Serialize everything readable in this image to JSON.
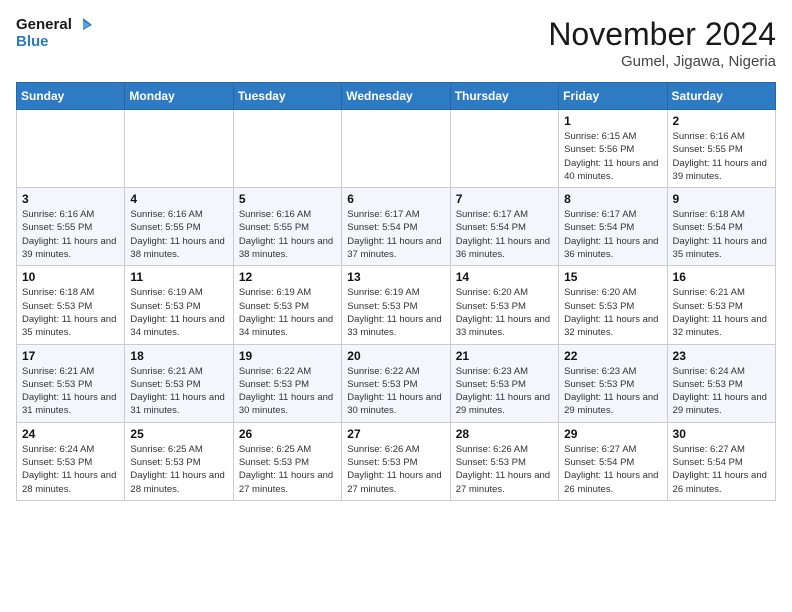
{
  "logo": {
    "line1": "General",
    "line2": "Blue"
  },
  "title": "November 2024",
  "location": "Gumel, Jigawa, Nigeria",
  "weekdays": [
    "Sunday",
    "Monday",
    "Tuesday",
    "Wednesday",
    "Thursday",
    "Friday",
    "Saturday"
  ],
  "weeks": [
    [
      {
        "day": "",
        "info": ""
      },
      {
        "day": "",
        "info": ""
      },
      {
        "day": "",
        "info": ""
      },
      {
        "day": "",
        "info": ""
      },
      {
        "day": "",
        "info": ""
      },
      {
        "day": "1",
        "info": "Sunrise: 6:15 AM\nSunset: 5:56 PM\nDaylight: 11 hours\nand 40 minutes."
      },
      {
        "day": "2",
        "info": "Sunrise: 6:16 AM\nSunset: 5:55 PM\nDaylight: 11 hours\nand 39 minutes."
      }
    ],
    [
      {
        "day": "3",
        "info": "Sunrise: 6:16 AM\nSunset: 5:55 PM\nDaylight: 11 hours\nand 39 minutes."
      },
      {
        "day": "4",
        "info": "Sunrise: 6:16 AM\nSunset: 5:55 PM\nDaylight: 11 hours\nand 38 minutes."
      },
      {
        "day": "5",
        "info": "Sunrise: 6:16 AM\nSunset: 5:55 PM\nDaylight: 11 hours\nand 38 minutes."
      },
      {
        "day": "6",
        "info": "Sunrise: 6:17 AM\nSunset: 5:54 PM\nDaylight: 11 hours\nand 37 minutes."
      },
      {
        "day": "7",
        "info": "Sunrise: 6:17 AM\nSunset: 5:54 PM\nDaylight: 11 hours\nand 36 minutes."
      },
      {
        "day": "8",
        "info": "Sunrise: 6:17 AM\nSunset: 5:54 PM\nDaylight: 11 hours\nand 36 minutes."
      },
      {
        "day": "9",
        "info": "Sunrise: 6:18 AM\nSunset: 5:54 PM\nDaylight: 11 hours\nand 35 minutes."
      }
    ],
    [
      {
        "day": "10",
        "info": "Sunrise: 6:18 AM\nSunset: 5:53 PM\nDaylight: 11 hours\nand 35 minutes."
      },
      {
        "day": "11",
        "info": "Sunrise: 6:19 AM\nSunset: 5:53 PM\nDaylight: 11 hours\nand 34 minutes."
      },
      {
        "day": "12",
        "info": "Sunrise: 6:19 AM\nSunset: 5:53 PM\nDaylight: 11 hours\nand 34 minutes."
      },
      {
        "day": "13",
        "info": "Sunrise: 6:19 AM\nSunset: 5:53 PM\nDaylight: 11 hours\nand 33 minutes."
      },
      {
        "day": "14",
        "info": "Sunrise: 6:20 AM\nSunset: 5:53 PM\nDaylight: 11 hours\nand 33 minutes."
      },
      {
        "day": "15",
        "info": "Sunrise: 6:20 AM\nSunset: 5:53 PM\nDaylight: 11 hours\nand 32 minutes."
      },
      {
        "day": "16",
        "info": "Sunrise: 6:21 AM\nSunset: 5:53 PM\nDaylight: 11 hours\nand 32 minutes."
      }
    ],
    [
      {
        "day": "17",
        "info": "Sunrise: 6:21 AM\nSunset: 5:53 PM\nDaylight: 11 hours\nand 31 minutes."
      },
      {
        "day": "18",
        "info": "Sunrise: 6:21 AM\nSunset: 5:53 PM\nDaylight: 11 hours\nand 31 minutes."
      },
      {
        "day": "19",
        "info": "Sunrise: 6:22 AM\nSunset: 5:53 PM\nDaylight: 11 hours\nand 30 minutes."
      },
      {
        "day": "20",
        "info": "Sunrise: 6:22 AM\nSunset: 5:53 PM\nDaylight: 11 hours\nand 30 minutes."
      },
      {
        "day": "21",
        "info": "Sunrise: 6:23 AM\nSunset: 5:53 PM\nDaylight: 11 hours\nand 29 minutes."
      },
      {
        "day": "22",
        "info": "Sunrise: 6:23 AM\nSunset: 5:53 PM\nDaylight: 11 hours\nand 29 minutes."
      },
      {
        "day": "23",
        "info": "Sunrise: 6:24 AM\nSunset: 5:53 PM\nDaylight: 11 hours\nand 29 minutes."
      }
    ],
    [
      {
        "day": "24",
        "info": "Sunrise: 6:24 AM\nSunset: 5:53 PM\nDaylight: 11 hours\nand 28 minutes."
      },
      {
        "day": "25",
        "info": "Sunrise: 6:25 AM\nSunset: 5:53 PM\nDaylight: 11 hours\nand 28 minutes."
      },
      {
        "day": "26",
        "info": "Sunrise: 6:25 AM\nSunset: 5:53 PM\nDaylight: 11 hours\nand 27 minutes."
      },
      {
        "day": "27",
        "info": "Sunrise: 6:26 AM\nSunset: 5:53 PM\nDaylight: 11 hours\nand 27 minutes."
      },
      {
        "day": "28",
        "info": "Sunrise: 6:26 AM\nSunset: 5:53 PM\nDaylight: 11 hours\nand 27 minutes."
      },
      {
        "day": "29",
        "info": "Sunrise: 6:27 AM\nSunset: 5:54 PM\nDaylight: 11 hours\nand 26 minutes."
      },
      {
        "day": "30",
        "info": "Sunrise: 6:27 AM\nSunset: 5:54 PM\nDaylight: 11 hours\nand 26 minutes."
      }
    ]
  ]
}
